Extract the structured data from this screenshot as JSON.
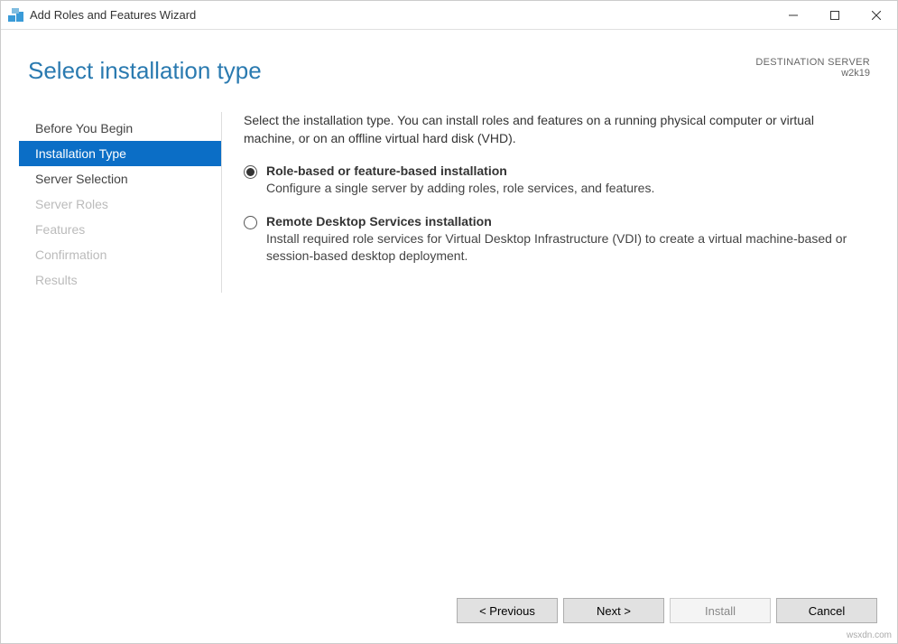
{
  "window": {
    "title": "Add Roles and Features Wizard"
  },
  "header": {
    "page_title": "Select installation type",
    "dest_label": "DESTINATION SERVER",
    "dest_value": "w2k19"
  },
  "sidebar": {
    "items": [
      {
        "label": "Before You Begin",
        "state": "enabled"
      },
      {
        "label": "Installation Type",
        "state": "selected"
      },
      {
        "label": "Server Selection",
        "state": "enabled"
      },
      {
        "label": "Server Roles",
        "state": "disabled"
      },
      {
        "label": "Features",
        "state": "disabled"
      },
      {
        "label": "Confirmation",
        "state": "disabled"
      },
      {
        "label": "Results",
        "state": "disabled"
      }
    ]
  },
  "content": {
    "intro": "Select the installation type. You can install roles and features on a running physical computer or virtual machine, or on an offline virtual hard disk (VHD).",
    "options": [
      {
        "title": "Role-based or feature-based installation",
        "desc": "Configure a single server by adding roles, role services, and features.",
        "checked": true
      },
      {
        "title": "Remote Desktop Services installation",
        "desc": "Install required role services for Virtual Desktop Infrastructure (VDI) to create a virtual machine-based or session-based desktop deployment.",
        "checked": false
      }
    ]
  },
  "footer": {
    "previous": "< Previous",
    "next": "Next >",
    "install": "Install",
    "cancel": "Cancel"
  },
  "watermark": "wsxdn.com"
}
